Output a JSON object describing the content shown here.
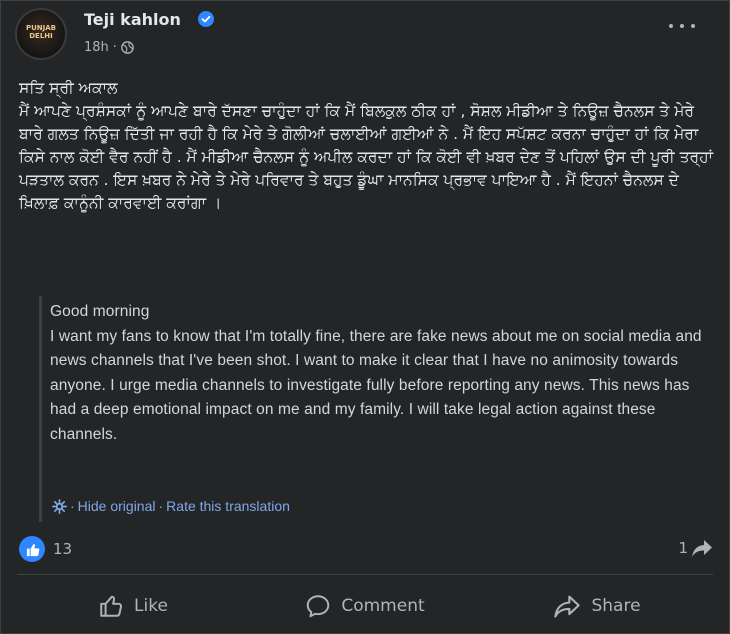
{
  "post": {
    "author": "Teji kahlon",
    "avatar_text": "PUNJAB\nDELHI",
    "time": "18h",
    "privacy_icon": "globe-icon",
    "more_icon": "more-horizontal-icon",
    "original_text": "ਸਤਿ ਸ੍ਰੀ ਅਕਾਲ\nਮੈਂ ਆਪਣੇ ਪ੍ਰਸ਼ੰਸਕਾਂ ਨੂੰ ਆਪਣੇ ਬਾਰੇ ਦੱਸਣਾ ਚਾਹੁੰਦਾ ਹਾਂ ਕਿ ਮੈਂ ਬਿਲਕੁਲ ਠੀਕ ਹਾਂ , ਸੋਸ਼ਲ ਮੀਡੀਆ ਤੇ ਨਿਊਜ਼ ਚੈਨਲਸ ਤੇ ਮੇਰੇ ਬਾਰੇ ਗਲਤ ਨਿਊਜ਼ ਦਿੱਤੀ ਜਾ ਰਹੀ ਹੈ ਕਿ ਮੇਰੇ ਤੇ ਗੋਲੀਆਂ ਚਲਾਈਆਂ ਗਈਆਂ ਨੇ . ਮੈਂ ਇਹ ਸਪੱਸ਼ਟ ਕਰਨਾ ਚਾਹੁੰਦਾ ਹਾਂ ਕਿ ਮੇਰਾ ਕਿਸੇ ਨਾਲ ਕੋਈ ਵੈਰ ਨਹੀਂ ਹੈ . ਮੈਂ ਮੀਡੀਆ ਚੈਨਲਸ ਨੂੰ ਅਪੀਲ ਕਰਦਾ ਹਾਂ ਕਿ ਕੋਈ ਵੀ ਖ਼ਬਰ ਦੇਣ ਤੋਂ ਪਹਿਲਾਂ ਉਸ ਦੀ ਪੂਰੀ ਤਰ੍ਹਾਂ ਪੜਤਾਲ ਕਰਨ . ਇਸ ਖ਼ਬਰ ਨੇ ਮੇਰੇ ਤੇ ਮੇਰੇ ਪਰਿਵਾਰ ਤੇ ਬਹੁਤ ਡੂੰਘਾ ਮਾਨਸਿਕ ਪ੍ਰਭਾਵ ਪਾਇਆ ਹੈ . ਮੈਂ ਇਹਨਾਂ ਚੈਨਲਸ ਦੇ ਖ਼ਿਲਾਫ਼ ਕਾਨੂੰਨੀ ਕਾਰਵਾਈ ਕਰਾਂਗਾ ।",
    "translation": "Good morning\nI want my fans to know that I'm totally fine, there are fake news about me on social media and news channels that I've been shot. I want to make it clear that I have no animosity towards anyone. I urge media channels to investigate fully before reporting any news. This news has had a deep emotional impact on me and my family. I will take legal action against these channels.",
    "hide_original": "Hide original",
    "separator": "·",
    "rate_translation": "Rate this translation",
    "reaction_count": "13",
    "share_count": "1"
  },
  "actions": {
    "like": "Like",
    "comment": "Comment",
    "share": "Share"
  },
  "colors": {
    "background": "#242526",
    "text": "#e4e6eb",
    "secondary": "#b0b3b8",
    "link": "#7fa8e8",
    "like_blue": "#2d88ff"
  }
}
